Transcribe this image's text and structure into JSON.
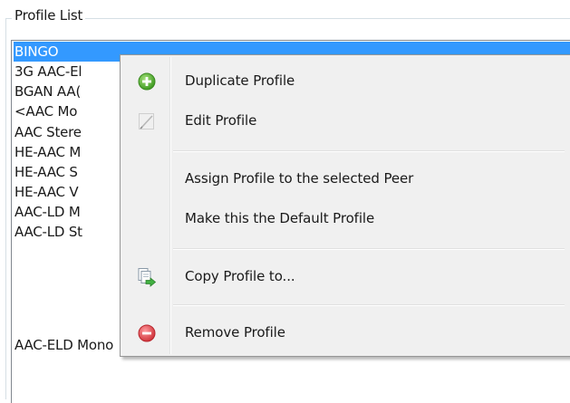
{
  "group": {
    "title": "Profile List"
  },
  "profiles": [
    {
      "label": "BINGO",
      "selected": true
    },
    {
      "label": "3G AAC-El",
      "selected": false
    },
    {
      "label": "BGAN AA(",
      "selected": false
    },
    {
      "label": "<AAC Mo",
      "selected": false
    },
    {
      "label": "AAC Stere",
      "selected": false
    },
    {
      "label": "HE-AAC M",
      "selected": false
    },
    {
      "label": "HE-AAC S",
      "selected": false
    },
    {
      "label": "HE-AAC V",
      "selected": false
    },
    {
      "label": "AAC-LD M",
      "selected": false
    },
    {
      "label": "AAC-LD St",
      "selected": false
    },
    {
      "label": "AAC-ELD Mono",
      "selected": false
    }
  ],
  "context_menu": {
    "items": [
      {
        "label": "Duplicate Profile",
        "icon": "add-circle-icon",
        "icon_color": "#5cb531"
      },
      {
        "label": "Edit Profile",
        "icon": "pencil-icon",
        "icon_color": "#c8c8c8"
      },
      {
        "label": "Assign Profile to the selected Peer",
        "icon": "",
        "icon_color": ""
      },
      {
        "label": "Make this the Default Profile",
        "icon": "",
        "icon_color": ""
      },
      {
        "label": "Copy Profile to...",
        "icon": "copy-document-arrow-icon",
        "icon_color": "#3aa13a"
      },
      {
        "label": "Remove Profile",
        "icon": "remove-circle-icon",
        "icon_color": "#e0484e"
      }
    ]
  },
  "colors": {
    "selection": "#3399ff",
    "menu_background": "#f0f0f0"
  }
}
